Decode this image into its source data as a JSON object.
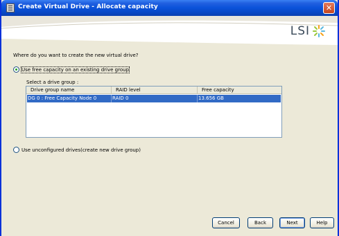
{
  "window": {
    "title": "Create Virtual Drive - Allocate capacity",
    "close_glyph": "✕",
    "brand": "LSI"
  },
  "content": {
    "question": "Where do you want to create the new virtual drive?",
    "option_existing": {
      "label": "Use free capacity on an existing drive group",
      "checked": true
    },
    "select_label": "Select a drive group :",
    "table": {
      "columns": [
        "Drive group name",
        "RAID level",
        "Free capacity"
      ],
      "rows": [
        {
          "name": "DG 0 : Free Capacity Node 0",
          "raid": "RAID 0",
          "capacity": "13.656 GB",
          "selected": true
        }
      ]
    },
    "option_unconfigured": {
      "label": "Use unconfigured drives(create new drive group)",
      "checked": false
    }
  },
  "buttons": {
    "cancel": "Cancel",
    "back": "Back",
    "next": "Next",
    "help": "Help"
  },
  "colors": {
    "titlebar": "#0a52d9",
    "selection": "#316ac5",
    "dialog_bg": "#ece9d8",
    "radio_dot": "#21a121"
  }
}
